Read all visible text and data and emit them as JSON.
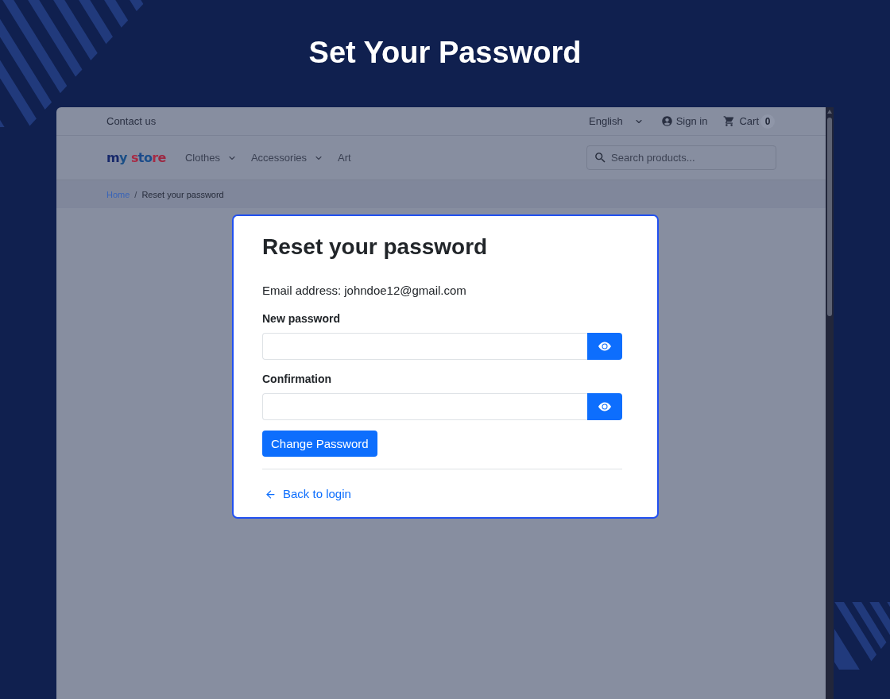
{
  "heading": {
    "title": "Set Your Password"
  },
  "topbar": {
    "contact": "Contact us",
    "language": "English",
    "sign_in": "Sign in",
    "cart": {
      "label": "Cart",
      "count": "0"
    }
  },
  "navbar": {
    "logo": "my store",
    "menu": [
      {
        "label": "Clothes",
        "has_dropdown": true
      },
      {
        "label": "Accessories",
        "has_dropdown": true
      },
      {
        "label": "Art",
        "has_dropdown": false
      }
    ],
    "search": {
      "placeholder": "Search products..."
    }
  },
  "breadcrumb": {
    "separator": "/",
    "items": [
      {
        "label": "Home",
        "kind": "link"
      },
      {
        "label": "Reset your password",
        "kind": "current"
      }
    ]
  },
  "reset_form": {
    "title": "Reset your password",
    "email": {
      "label": "Email address:",
      "value": "johndoe12@gmail.com"
    },
    "fields": [
      {
        "label": "New password"
      },
      {
        "label": "Confirmation"
      }
    ],
    "submit": "Change Password",
    "back_link": "Back to login"
  }
}
